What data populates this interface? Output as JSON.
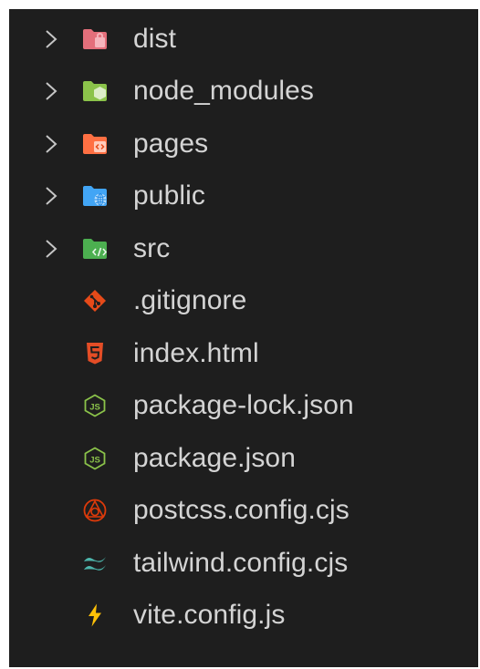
{
  "explorer": {
    "items": [
      {
        "label": "dist",
        "kind": "folder",
        "icon": "dist-folder-icon",
        "color": "#e46f7b"
      },
      {
        "label": "node_modules",
        "kind": "folder",
        "icon": "node-modules-folder-icon",
        "color": "#8bc34a"
      },
      {
        "label": "pages",
        "kind": "folder",
        "icon": "pages-folder-icon",
        "color": "#ff7043"
      },
      {
        "label": "public",
        "kind": "folder",
        "icon": "public-folder-icon",
        "color": "#42a5f5"
      },
      {
        "label": "src",
        "kind": "folder",
        "icon": "src-folder-icon",
        "color": "#4caf50"
      },
      {
        "label": ".gitignore",
        "kind": "file",
        "icon": "git-icon",
        "color": "#e64a19"
      },
      {
        "label": "index.html",
        "kind": "file",
        "icon": "html5-icon",
        "color": "#e44d26"
      },
      {
        "label": "package-lock.json",
        "kind": "file",
        "icon": "nodejs-icon",
        "color": "#8bc34a"
      },
      {
        "label": "package.json",
        "kind": "file",
        "icon": "nodejs-icon",
        "color": "#8bc34a"
      },
      {
        "label": "postcss.config.cjs",
        "kind": "file",
        "icon": "postcss-icon",
        "color": "#dd3a0a"
      },
      {
        "label": "tailwind.config.cjs",
        "kind": "file",
        "icon": "tailwind-icon",
        "color": "#4db6ac"
      },
      {
        "label": "vite.config.js",
        "kind": "file",
        "icon": "vite-icon",
        "color": "#ffc107"
      }
    ]
  }
}
